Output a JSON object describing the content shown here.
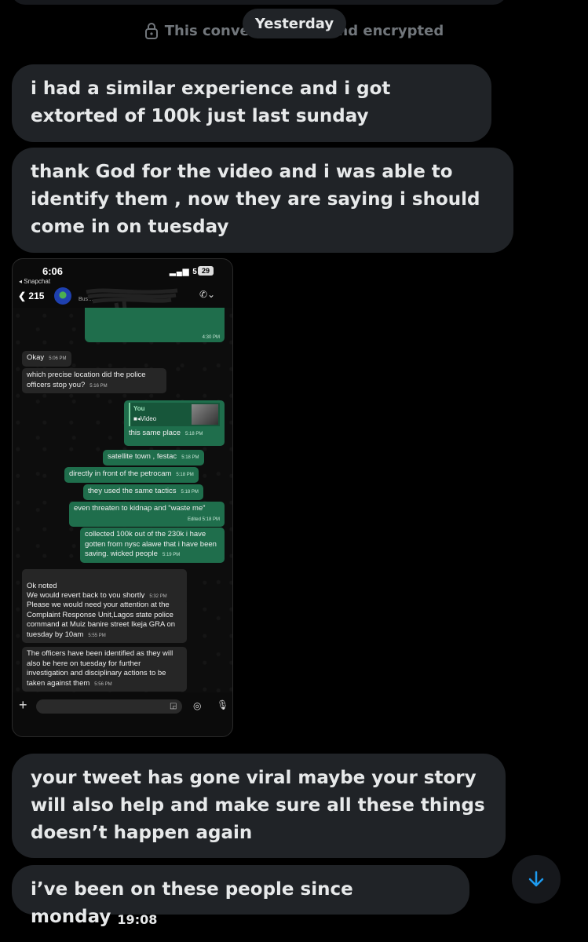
{
  "header": {
    "encryption_notice": "This conversati…-to-end encrypted",
    "date_pill": "Yesterday"
  },
  "messages": [
    {
      "text": "i had a similar experience and i got extorted of 100k just last sunday"
    },
    {
      "text": "thank God for the video and i was able to identify them , now they are saying i should come in on tuesday"
    },
    {
      "text": "your tweet has gone viral maybe your story will also help and make sure all these things doesn’t happen again"
    },
    {
      "text": "i’ve been on these people since monday",
      "time": "19:08"
    }
  ],
  "attachment": {
    "status_time": "6:06",
    "back_app": "◂ Snapchat",
    "network": "5G",
    "battery": "29",
    "back_count": "215",
    "contact_sub": "Bus…",
    "prev_msg_time": "4:30 PM",
    "chat": [
      {
        "side": "in",
        "text": "Okay",
        "time": "5:06 PM"
      },
      {
        "side": "in",
        "text": "which precise location did the police officers stop you?",
        "time": "5:16 PM"
      },
      {
        "side": "out",
        "reply_label": "You",
        "reply_type": "Video",
        "text": "this same place",
        "time": "5:18 PM"
      },
      {
        "side": "out",
        "text": "satellite town , festac",
        "time": "5:18 PM"
      },
      {
        "side": "out",
        "text": "directly in front of the petrocam",
        "time": "5:18 PM"
      },
      {
        "side": "out",
        "text": "they used the same tactics",
        "time": "5:18 PM"
      },
      {
        "side": "out",
        "text": "even threaten to kidnap and “waste me”",
        "time": "Edited 5:18 PM"
      },
      {
        "side": "out",
        "text": "collected 100k out of the 230k i have gotten from nysc alawe that i have been saving. wicked people",
        "time": "5:19 PM"
      },
      {
        "side": "in",
        "text": "Ok noted\nWe would revert back to you shortly",
        "time": "5:32 PM"
      },
      {
        "side": "in",
        "text": "Please we would need your attention at the Complaint Response Unit,Lagos state police command at Muiz banire street Ikeja GRA on tuesday by 10am",
        "time": "5:55 PM"
      },
      {
        "side": "in",
        "text": "The officers have been identified as they will also be here on tuesday for further investigation and disciplinary actions to be taken against them",
        "time": "5:56 PM"
      }
    ]
  },
  "icons": {
    "lock": "lock-icon",
    "scroll_down": "arrow-down-icon"
  },
  "colors": {
    "background": "#000000",
    "bubble": "#202327",
    "muted_text": "#71767b",
    "accent": "#1d9bf0",
    "whatsapp_out": "#1f6e4c"
  }
}
